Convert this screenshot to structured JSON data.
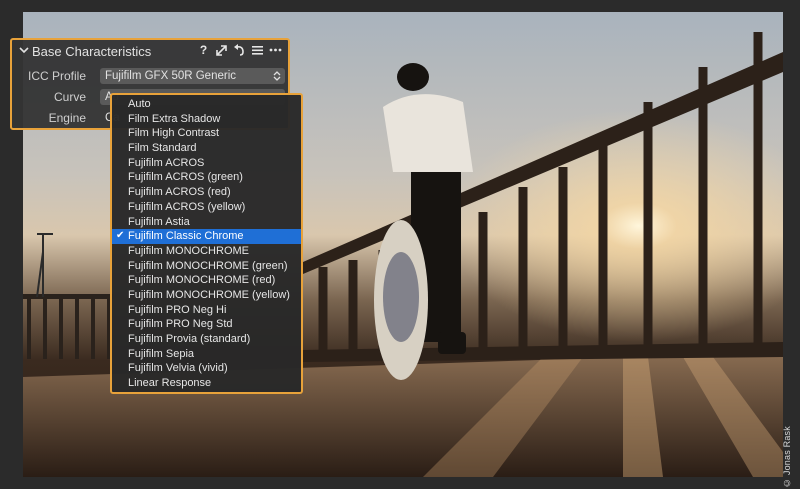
{
  "panel": {
    "title": "Base Characteristics",
    "icons": [
      "help-icon",
      "expand-icon",
      "reset-icon",
      "list-icon",
      "more-icon"
    ],
    "rows": [
      {
        "label": "ICC Profile",
        "value": "Fujifilm GFX 50R Generic"
      },
      {
        "label": "Curve",
        "value": "Au"
      },
      {
        "label": "Engine",
        "value": "Ca"
      }
    ]
  },
  "dropdown": {
    "selected_index": 9,
    "options": [
      "Auto",
      "Film Extra Shadow",
      "Film High Contrast",
      "Film Standard",
      "Fujifilm ACROS",
      "Fujifilm ACROS (green)",
      "Fujifilm ACROS (red)",
      "Fujifilm ACROS (yellow)",
      "Fujifilm Astia",
      "Fujifilm Classic Chrome",
      "Fujifilm MONOCHROME",
      "Fujifilm MONOCHROME (green)",
      "Fujifilm MONOCHROME (red)",
      "Fujifilm MONOCHROME (yellow)",
      "Fujifilm PRO Neg Hi",
      "Fujifilm PRO Neg Std",
      "Fujifilm Provia (standard)",
      "Fujifilm Sepia",
      "Fujifilm Velvia (vivid)",
      "Linear Response"
    ]
  },
  "photo": {
    "credit": "© Jonas Rask"
  },
  "colors": {
    "accent": "#e8a23a",
    "selection": "#1f6fd6"
  }
}
